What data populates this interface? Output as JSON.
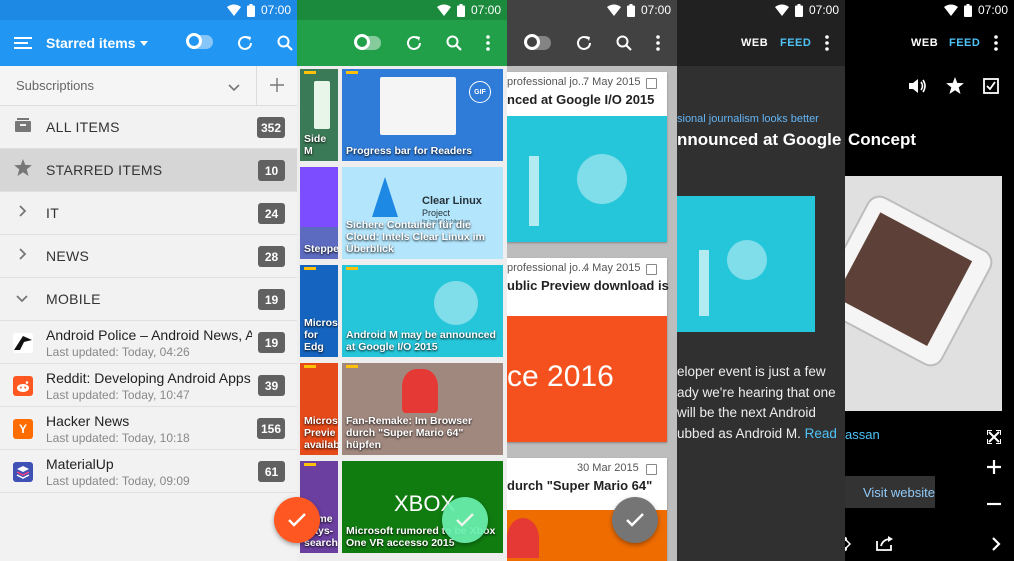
{
  "status": {
    "time": "07:00"
  },
  "p1": {
    "title": "Starred items",
    "subscriptions_label": "Subscriptions",
    "categories": [
      {
        "label": "ALL ITEMS",
        "count": "352",
        "icon": "inbox-icon"
      },
      {
        "label": "STARRED ITEMS",
        "count": "10",
        "icon": "star-icon"
      },
      {
        "label": "IT",
        "count": "24",
        "icon": "chevron-right-icon"
      },
      {
        "label": "NEWS",
        "count": "28",
        "icon": "chevron-right-icon"
      },
      {
        "label": "MOBILE",
        "count": "19",
        "icon": "chevron-down-icon"
      }
    ],
    "feeds": [
      {
        "title": "Android Police – Android News, A...",
        "updated": "Last updated: Today, 04:26",
        "count": "19",
        "icon": "android-police-icon"
      },
      {
        "title": "Reddit: Developing Android Apps",
        "updated": "Last updated: Today, 10:47",
        "count": "39",
        "icon": "reddit-icon"
      },
      {
        "title": "Hacker News",
        "updated": "Last updated: Today, 10:18",
        "count": "156",
        "icon": "hacker-news-icon",
        "letter": "Y"
      },
      {
        "title": "MaterialUp",
        "updated": "Last updated: Today, 09:09",
        "count": "61",
        "icon": "materialup-icon"
      }
    ]
  },
  "p2": {
    "left_captions": [
      "Side M",
      "Steppe",
      "Micros for Edg",
      "Micros Previe availab",
      "Some ways- search"
    ],
    "tiles": [
      {
        "caption": "Progress bar for Readers"
      },
      {
        "caption": "Sichere Container für die Cloud: Intels Clear Linux im Überblick",
        "logo_title": "Clear Linux",
        "logo_sub": "Project",
        "logo_small": "for Intel® Architecture"
      },
      {
        "caption": "Android M may be announced at Google I/O 2015"
      },
      {
        "caption": "Fan-Remake: Im Browser durch \"Super Mario 64\" hüpfen"
      },
      {
        "caption": "Microsoft rumored to be Xbox One VR accesso 2015",
        "logo": "XBOX"
      }
    ],
    "gif_badge": "GIF"
  },
  "p3": {
    "cards": [
      {
        "meta": "professional jo...",
        "date": "7 May 2015",
        "headline": "nced at Google I/O 2015"
      },
      {
        "meta": "professional jo...",
        "date": "4 May 2015",
        "headline": "ublic Preview download is",
        "image_text": "ce 2016"
      },
      {
        "meta": "",
        "date": "30 Mar 2015",
        "headline": "durch \"Super Mario 64\""
      }
    ]
  },
  "p4": {
    "web": "WEB",
    "feed": "FEED",
    "source": "sional journalism looks better",
    "headline": "nnounced at Google",
    "body": [
      "eloper event is just a few",
      "ady we're hearing that one",
      "will be the next Android",
      "ubbed as Android M."
    ],
    "read": "Read"
  },
  "p5": {
    "web": "WEB",
    "feed": "FEED",
    "headline": "Concept",
    "author": "assan",
    "visit": "Visit website"
  }
}
